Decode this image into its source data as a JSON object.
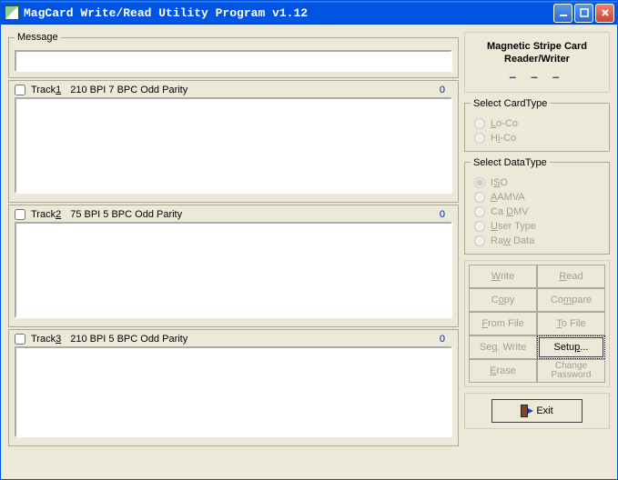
{
  "window": {
    "title": "MagCard Write/Read Utility Program v1.12"
  },
  "message": {
    "legend": "Message",
    "value": ""
  },
  "tracks": [
    {
      "checklabel_pre": "Track",
      "checklabel_u": "1",
      "info": "210 BPI  7 BPC  Odd Parity",
      "count": "0",
      "value": ""
    },
    {
      "checklabel_pre": "Track",
      "checklabel_u": "2",
      "info": "75 BPI  5 BPC  Odd Parity",
      "count": "0",
      "value": ""
    },
    {
      "checklabel_pre": "Track",
      "checklabel_u": "3",
      "info": "210 BPI  5 BPC  Odd Parity",
      "count": "0",
      "value": ""
    }
  ],
  "brand": {
    "line1": "Magnetic Stripe Card",
    "line2": "Reader/Writer",
    "dashes": "– – –"
  },
  "cardtype": {
    "legend": "Select CardType",
    "options": [
      {
        "pre": "",
        "u": "L",
        "post": "o-Co"
      },
      {
        "pre": "H",
        "u": "i",
        "post": "-Co"
      }
    ]
  },
  "datatype": {
    "legend": "Select DataType",
    "options": [
      {
        "pre": "I",
        "u": "S",
        "post": "O",
        "selected": true
      },
      {
        "pre": "",
        "u": "A",
        "post": "AMVA"
      },
      {
        "pre": "Ca ",
        "u": "D",
        "post": "MV"
      },
      {
        "pre": "",
        "u": "U",
        "post": "ser Type"
      },
      {
        "pre": "Ra",
        "u": "w",
        "post": " Data"
      }
    ]
  },
  "buttons": {
    "write": {
      "u": "W",
      "post": "rite"
    },
    "read": {
      "u": "R",
      "post": "ead"
    },
    "copy": {
      "pre": "C",
      "u": "o",
      "post": "py"
    },
    "compare": {
      "pre": "Co",
      "u": "m",
      "post": "pare"
    },
    "fromfile": {
      "u": "F",
      "post": "rom File"
    },
    "tofile": {
      "u": "T",
      "post": "o File"
    },
    "seqwrite": {
      "pre": "Se",
      "u": "q",
      "post": ". Write"
    },
    "setup": {
      "pre": "Setu",
      "u": "p",
      "post": "..."
    },
    "erase": {
      "u": "E",
      "post": "rase"
    },
    "chpwd_l1": "Change",
    "chpwd_l2": "Password",
    "exit": {
      "pre": "E",
      "u": "x",
      "post": "it"
    }
  }
}
